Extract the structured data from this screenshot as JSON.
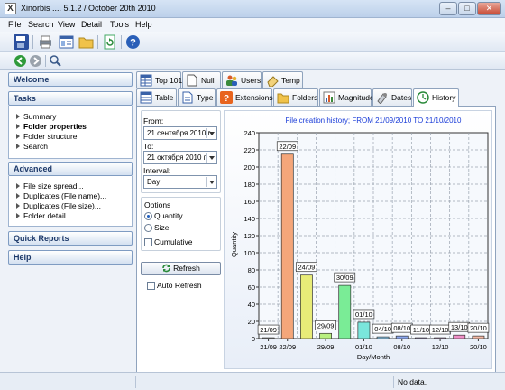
{
  "window": {
    "title": "Xinorbis .... 5.1.2 / October 20th 2010",
    "app_icon": "X"
  },
  "menu": [
    "File",
    "Search",
    "View",
    "Detail",
    "Tools",
    "Help"
  ],
  "sidebar": {
    "welcome": "Welcome",
    "tasks": {
      "title": "Tasks",
      "items": [
        "Summary",
        "Folder properties",
        "Folder structure",
        "Search"
      ],
      "active": "Folder properties"
    },
    "advanced": {
      "title": "Advanced",
      "items": [
        "File size spread...",
        "Duplicates (File name)...",
        "Duplicates (File size)...",
        "Folder detail..."
      ]
    },
    "quick_reports": "Quick Reports",
    "help": "Help"
  },
  "tabs_top": [
    {
      "label": "Top 101",
      "icon": "table-icon"
    },
    {
      "label": "Null",
      "icon": "null-file-icon"
    },
    {
      "label": "Users",
      "icon": "users-icon"
    },
    {
      "label": "Temp",
      "icon": "eraser-icon"
    }
  ],
  "tabs_bottom": [
    {
      "label": "Table",
      "icon": "table-icon"
    },
    {
      "label": "Type",
      "icon": "document-icon"
    },
    {
      "label": "Extensions",
      "icon": "question-icon"
    },
    {
      "label": "Folders",
      "icon": "folder-icon"
    },
    {
      "label": "Magnitude",
      "icon": "chart-icon"
    },
    {
      "label": "Dates",
      "icon": "calendar-icon"
    },
    {
      "label": "History",
      "icon": "history-icon"
    }
  ],
  "active_tab": "History",
  "options": {
    "from_label": "From:",
    "from_value": "21 сентября 2010 г.",
    "to_label": "To:",
    "to_value": "21  октября 2010 г.",
    "interval_label": "Interval:",
    "interval_value": "Day",
    "options_label": "Options",
    "radio_quantity": "Quantity",
    "radio_size": "Size",
    "selected_radio": "Quantity",
    "cumulative": "Cumulative",
    "refresh": "Refresh",
    "auto_refresh": "Auto Refresh"
  },
  "status": {
    "text": "No data."
  },
  "chart_data": {
    "type": "bar",
    "title": "File creation history; FROM 21/09/2010 TO 21/10/2010",
    "xlabel": "Day/Month",
    "ylabel": "Quantity",
    "ylim": [
      0,
      240
    ],
    "yticks": [
      0,
      20,
      40,
      60,
      80,
      100,
      120,
      140,
      160,
      180,
      200,
      220,
      240
    ],
    "xtick_labels": [
      "21/09",
      "22/09",
      "29/09",
      "01/10",
      "08/10",
      "12/10",
      "20/10"
    ],
    "grid": true,
    "categories": [
      "21/09",
      "22/09",
      "24/09",
      "29/09",
      "30/09",
      "01/10",
      "04/10",
      "08/10",
      "11/10",
      "12/10",
      "13/10",
      "20/10"
    ],
    "values": [
      1,
      215,
      74,
      6,
      62,
      19,
      2,
      3,
      1,
      1,
      4,
      3
    ],
    "colors": [
      "#b0b0b0",
      "#f4a67a",
      "#e8ec78",
      "#b8f080",
      "#7aec96",
      "#7ae6dc",
      "#8ccbf0",
      "#8ca8f0",
      "#c0a6f0",
      "#e2a6ee",
      "#f090c8",
      "#f4b8a4"
    ],
    "data_labels": [
      "21/09",
      "22/09",
      "24/09",
      "29/09",
      "30/09",
      "01/10",
      "04/10",
      "08/10",
      "11/10",
      "12/10",
      "13/10",
      "20/10"
    ]
  }
}
